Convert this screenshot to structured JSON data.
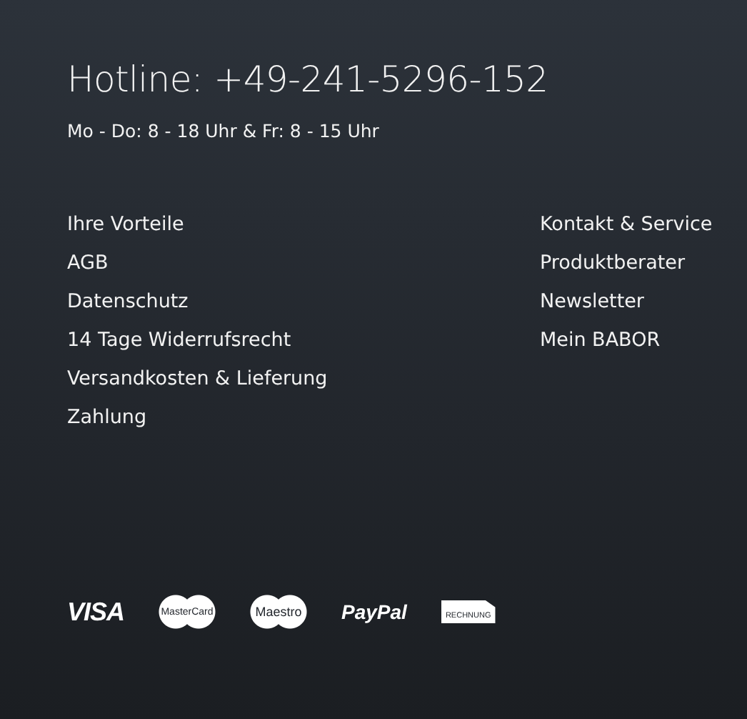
{
  "hotline": "Hotline: +49-241-5296-152",
  "hours": "Mo - Do: 8 - 18 Uhr & Fr: 8 - 15 Uhr",
  "link_columns": [
    [
      "Ihre Vorteile",
      "AGB",
      "Datenschutz",
      "14 Tage Widerrufsrecht",
      "Versandkosten & Lieferung",
      "Zahlung"
    ],
    [
      "Kontakt & Service",
      "Produktberater",
      "Newsletter",
      "Mein BABOR"
    ]
  ],
  "payments": [
    {
      "kind": "visa",
      "label": "VISA"
    },
    {
      "kind": "mastercard",
      "label": "MasterCard"
    },
    {
      "kind": "maestro",
      "label": "Maestro"
    },
    {
      "kind": "paypal",
      "label": "PayPal"
    },
    {
      "kind": "invoice",
      "label": "RECHNUNG"
    }
  ]
}
